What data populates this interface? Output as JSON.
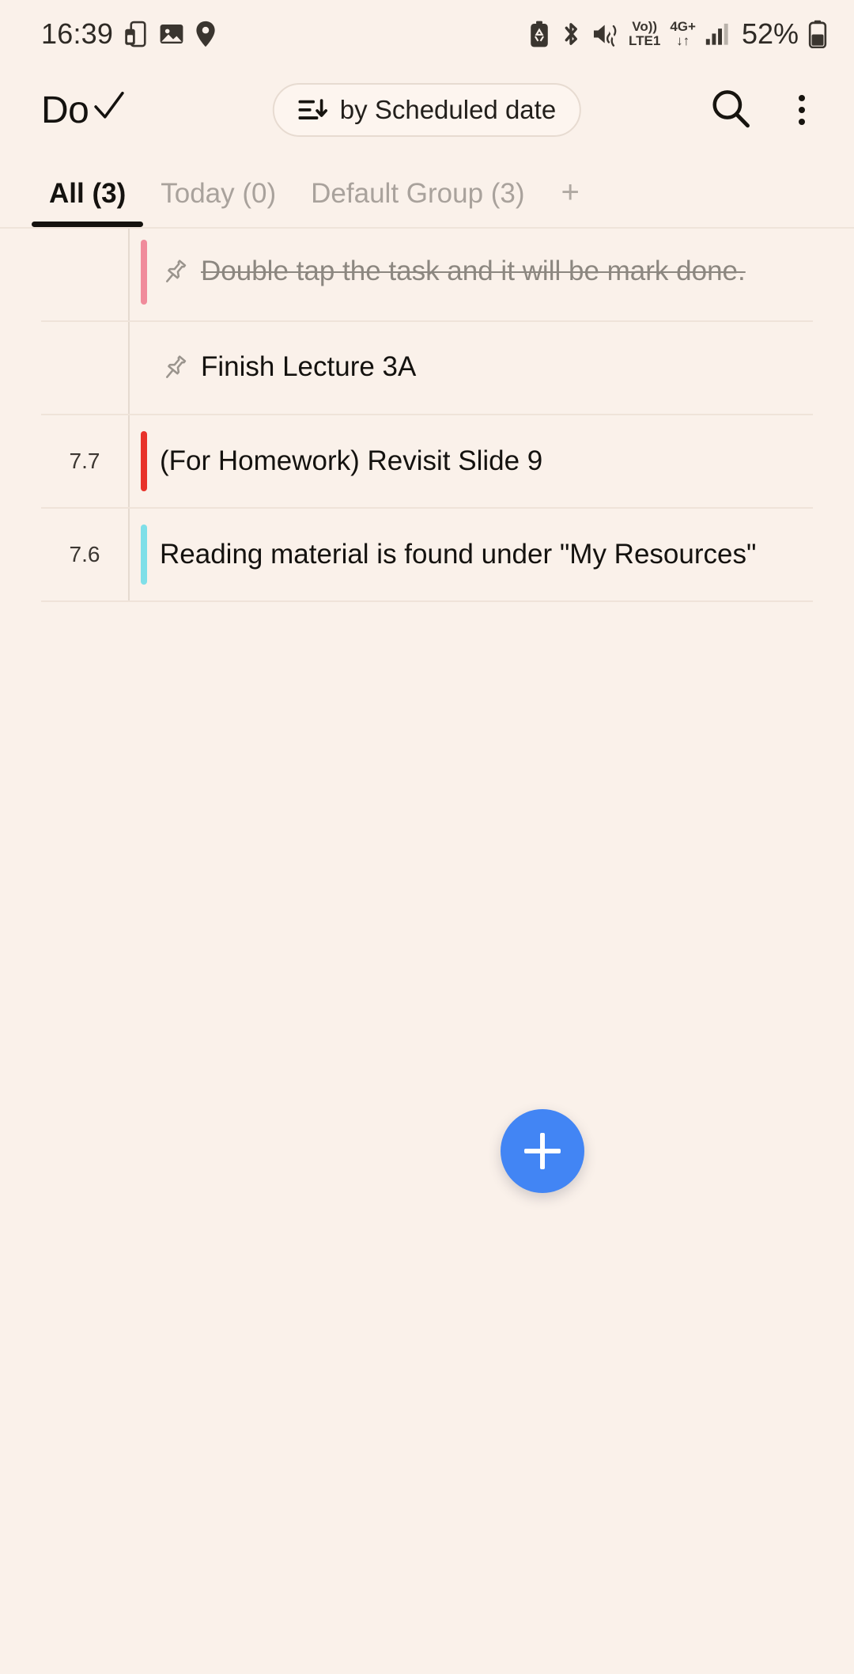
{
  "status_bar": {
    "time": "16:39",
    "left_icons": [
      "screen-mirror-icon",
      "gallery-icon",
      "location-pin-icon"
    ],
    "right_icons": [
      "battery-saver-icon",
      "bluetooth-icon",
      "mute-vibrate-icon"
    ],
    "volte_top": "Vo))",
    "volte_bottom": "LTE1",
    "network_top": "4G+",
    "network_bottom": "↓↑",
    "signal_icon": "signal-bars-icon",
    "battery_percent": "52%",
    "battery_icon": "battery-icon"
  },
  "app_bar": {
    "title": "Do",
    "check_icon": "check-icon",
    "sort": {
      "icon": "sort-descending-icon",
      "label": "by Scheduled date"
    },
    "search_icon": "search-icon",
    "overflow_icon": "more-vertical-icon"
  },
  "tabs": {
    "items": [
      {
        "label": "All (3)",
        "active": true
      },
      {
        "label": "Today (0)",
        "active": false
      },
      {
        "label": "Default Group (3)",
        "active": false
      }
    ],
    "add_label": "+"
  },
  "tasks": [
    {
      "date": "",
      "accent_color": "#f08b9b",
      "pinned": true,
      "completed": true,
      "title": "Double tap the task and it will be mark done."
    },
    {
      "date": "",
      "accent_color": "",
      "pinned": true,
      "completed": false,
      "title": "Finish Lecture 3A"
    },
    {
      "date": "7.7",
      "accent_color": "#e8322a",
      "pinned": false,
      "completed": false,
      "title": "(For Homework) Revisit Slide 9"
    },
    {
      "date": "7.6",
      "accent_color": "#7fdfe8",
      "pinned": false,
      "completed": false,
      "title": "Reading material is found under \"My Resources\""
    }
  ],
  "fab": {
    "icon": "plus-icon",
    "color": "#4285f4"
  },
  "colors": {
    "background": "#faf1ea",
    "text_primary": "#14120f",
    "text_muted": "#a9a29c",
    "divider": "#efe3d9"
  }
}
